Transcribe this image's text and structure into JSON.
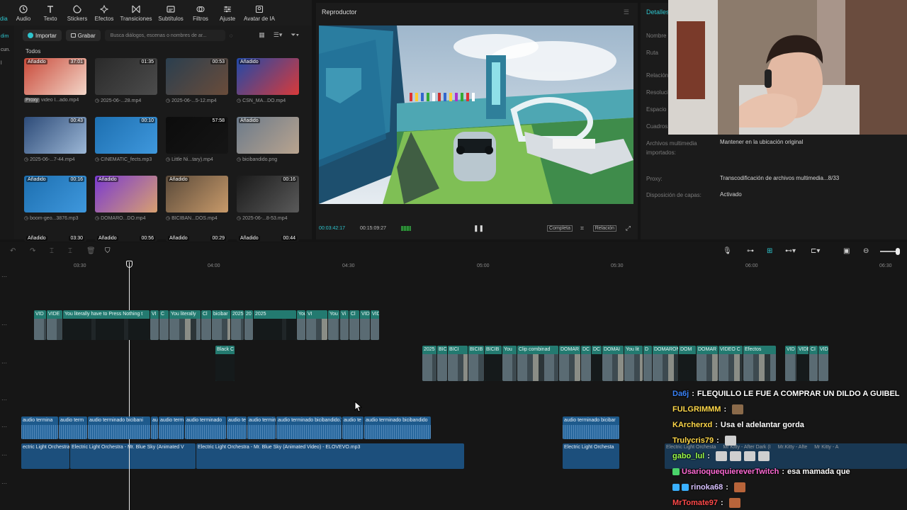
{
  "toolbar": {
    "items": [
      {
        "label": "Audio",
        "icon": "audio-icon"
      },
      {
        "label": "Texto",
        "icon": "text-icon"
      },
      {
        "label": "Stickers",
        "icon": "sticker-icon"
      },
      {
        "label": "Efectos",
        "icon": "effects-icon"
      },
      {
        "label": "Transiciones",
        "icon": "transitions-icon"
      },
      {
        "label": "Subtítulos",
        "icon": "subtitles-icon"
      },
      {
        "label": "Filtros",
        "icon": "filters-icon"
      },
      {
        "label": "Ajuste",
        "icon": "adjust-icon"
      },
      {
        "label": "Avatar de IA",
        "icon": "ai-avatar-icon"
      }
    ],
    "partial_label": "dia"
  },
  "left_strip": {
    "items": [
      "dim",
      "cun.",
      "l"
    ]
  },
  "media": {
    "import_label": "Importar",
    "record_label": "Grabar",
    "search_placeholder": "Busca diálogos, escenas o nombres de ar...",
    "all_label": "Todos",
    "items": [
      {
        "badge": "Añadido",
        "duration": "37:01",
        "name": "video l...ado.mp4",
        "tag": "Proxy",
        "colors": [
          "#c94a3a",
          "#f3d6c8"
        ]
      },
      {
        "badge": "",
        "duration": "01:35",
        "name": "2025-06-...28.mp4",
        "tag": "",
        "colors": [
          "#2a2a2a",
          "#4c4c4c"
        ]
      },
      {
        "badge": "",
        "duration": "00:53",
        "name": "2025-06-...5-12.mp4",
        "tag": "",
        "colors": [
          "#2b3f4f",
          "#6a4c3a"
        ]
      },
      {
        "badge": "Añadido",
        "duration": "",
        "name": "CSN_MA...DO.mp4",
        "tag": "",
        "colors": [
          "#2149a8",
          "#d83a3a"
        ]
      },
      {
        "badge": "",
        "duration": "00:43",
        "name": "2025-06-...7-44.mp4",
        "tag": "",
        "colors": [
          "#2d4b78",
          "#9cb7d6"
        ]
      },
      {
        "badge": "",
        "duration": "00:10",
        "name": "CINEMATIC_fects.mp3",
        "tag": "",
        "colors": [
          "#1d6fb0",
          "#3f98dd"
        ]
      },
      {
        "badge": "",
        "duration": "57:58",
        "name": "Little Ni...tary).mp4",
        "tag": "",
        "colors": [
          "#0c0c0c",
          "#151515"
        ]
      },
      {
        "badge": "Añadido",
        "duration": "",
        "name": "bicibandido.png",
        "tag": "",
        "colors": [
          "#6b7a8a",
          "#b9a48f"
        ]
      },
      {
        "badge": "Añadido",
        "duration": "00:16",
        "name": "boom-geo...3876.mp3",
        "tag": "",
        "colors": [
          "#1d6fb0",
          "#3f98dd"
        ]
      },
      {
        "badge": "Añadido",
        "duration": "",
        "name": "DOMARO...DO.mp4",
        "tag": "",
        "colors": [
          "#7a3ad0",
          "#d8a070"
        ]
      },
      {
        "badge": "Añadido",
        "duration": "",
        "name": "BICIBAN...DOS.mp4",
        "tag": "",
        "colors": [
          "#5a4a3a",
          "#c89a6a"
        ]
      },
      {
        "badge": "",
        "duration": "00:16",
        "name": "2025-06-...8-53.mp4",
        "tag": "",
        "colors": [
          "#1a1a1a",
          "#5a5a5a"
        ]
      },
      {
        "badge": "Añadido",
        "duration": "03:30",
        "name": "",
        "tag": "",
        "colors": [
          "#1a1a1a",
          "#1a1a1a"
        ]
      },
      {
        "badge": "Añadido",
        "duration": "00:56",
        "name": "",
        "tag": "",
        "colors": [
          "#1a1a1a",
          "#1a1a1a"
        ]
      },
      {
        "badge": "Añadido",
        "duration": "00:29",
        "name": "",
        "tag": "",
        "colors": [
          "#1a1a1a",
          "#1a1a1a"
        ]
      },
      {
        "badge": "Añadido",
        "duration": "00:44",
        "name": "",
        "tag": "",
        "colors": [
          "#1a1a1a",
          "#1a1a1a"
        ]
      }
    ]
  },
  "player": {
    "title": "Reproductor",
    "current_time": "00:03:42:17",
    "total_time": "00:15:09:27",
    "full_label": "Completa",
    "ratio_label": "Relación"
  },
  "details": {
    "tab": "Detalles",
    "props": [
      {
        "label": "Nombre",
        "value": ""
      },
      {
        "label": "Ruta",
        "value": ""
      },
      {
        "label": "Relación",
        "value": ""
      },
      {
        "label": "Resolución",
        "value": ""
      },
      {
        "label": "Espacio",
        "value": ""
      },
      {
        "label": "Cuadros",
        "value": ""
      },
      {
        "label": "Archivos multimedia importados:",
        "value": "Mantener en la ubicación original"
      },
      {
        "label": "Proxy:",
        "value": "Transcodificación de archivos multimedia...8/33"
      },
      {
        "label": "Disposición de capas:",
        "value": "Activado"
      }
    ]
  },
  "timeline": {
    "ruler": [
      "03:30",
      "04:00",
      "04:30",
      "05:00",
      "05:30",
      "06:00",
      "06:30"
    ],
    "video_row1": [
      "VID",
      "VIDE",
      "You literally have to Press Nothing t",
      "VI",
      "C",
      "You literally",
      "Cl",
      "bicibar",
      "2025",
      "20",
      "2025",
      "You literally h",
      "VI",
      "You li",
      "Vi",
      "Cl",
      "VID",
      "VID"
    ],
    "black_clip": "Black C",
    "video_row2": [
      "2025",
      "BICIBA",
      "BICI",
      "BICIB",
      "BICIB",
      "You",
      "Clip combinad",
      "DOMAR",
      "DC",
      "DC",
      "DOMAI",
      "You lit",
      "D",
      "DOMARON A",
      "DOM",
      "DOMAR",
      "VIDEO C",
      "Efectos",
      "VID",
      "VIDE",
      "CI",
      "VIDEO C"
    ],
    "audio_segments": [
      "audio termina",
      "audio term",
      "audio terminado bicibani",
      "audio te",
      "audio term",
      "audio terminado",
      "audio te",
      "audio terminad",
      "audio terminado bicibandido.Wa",
      "audio te",
      "audio terminado bicibandido"
    ],
    "audio_right": "audio terminado bicibar",
    "music_main": "Electric Light Orchestra - Mr. Blue Sky (Animated Video) - ELOVEVO.mp3",
    "music_left": "ectric Light Orchestra",
    "music_mid": "Electric Light Orchestra - Mr. Blue Sky (Animated V",
    "music_right": "Electric Light Orchesta",
    "music_far": [
      "Electric Light Orchesta",
      "Mr Kitty - After Dark (I",
      "Mr.Kitty - Afte",
      "Mr Kitty - A"
    ]
  },
  "chat": [
    {
      "user": "Da6j",
      "user_color": "#3a82f6",
      "message": "FLEQUILLO LE FUE A COMPRAR UN DILDO A GUIBEL",
      "badges": []
    },
    {
      "user": "FULGRIMMM",
      "user_color": "#ffd84a",
      "message": "",
      "badges": [],
      "emotes": [
        "#8a6a4a"
      ]
    },
    {
      "user": "KArcherxd",
      "user_color": "#ffd84a",
      "message": "Usa el adelantar gorda",
      "badges": []
    },
    {
      "user": "Trulycris79",
      "user_color": "#ffd84a",
      "message": "",
      "badges": [],
      "emotes": [
        "#cfcfcf"
      ]
    },
    {
      "user": "gabo_lul",
      "user_color": "#9cff4a",
      "message": "",
      "badges": [],
      "emotes": [
        "#cfcfcf",
        "#cfcfcf",
        "#cfcfcf",
        "#cfcfcf"
      ]
    },
    {
      "user": "UsarioquequiereverTwitch",
      "user_color": "#ff6ad5",
      "message": "esa mamada que",
      "badges": [
        "#4ad36a"
      ]
    },
    {
      "user": "rinoka68",
      "user_color": "#d9c2ff",
      "message": "",
      "badges": [
        "#3ab0ff",
        "#3ab0ff"
      ],
      "emotes": [
        "#b8643a"
      ]
    },
    {
      "user": "MrTomate97",
      "user_color": "#ff4a4a",
      "message": "",
      "badges": [],
      "emotes": [
        "#b8643a"
      ]
    }
  ],
  "colors": {
    "accent": "#2ec5ce",
    "video_track": "#1c6e64",
    "audio_track": "#1e5a8c"
  }
}
